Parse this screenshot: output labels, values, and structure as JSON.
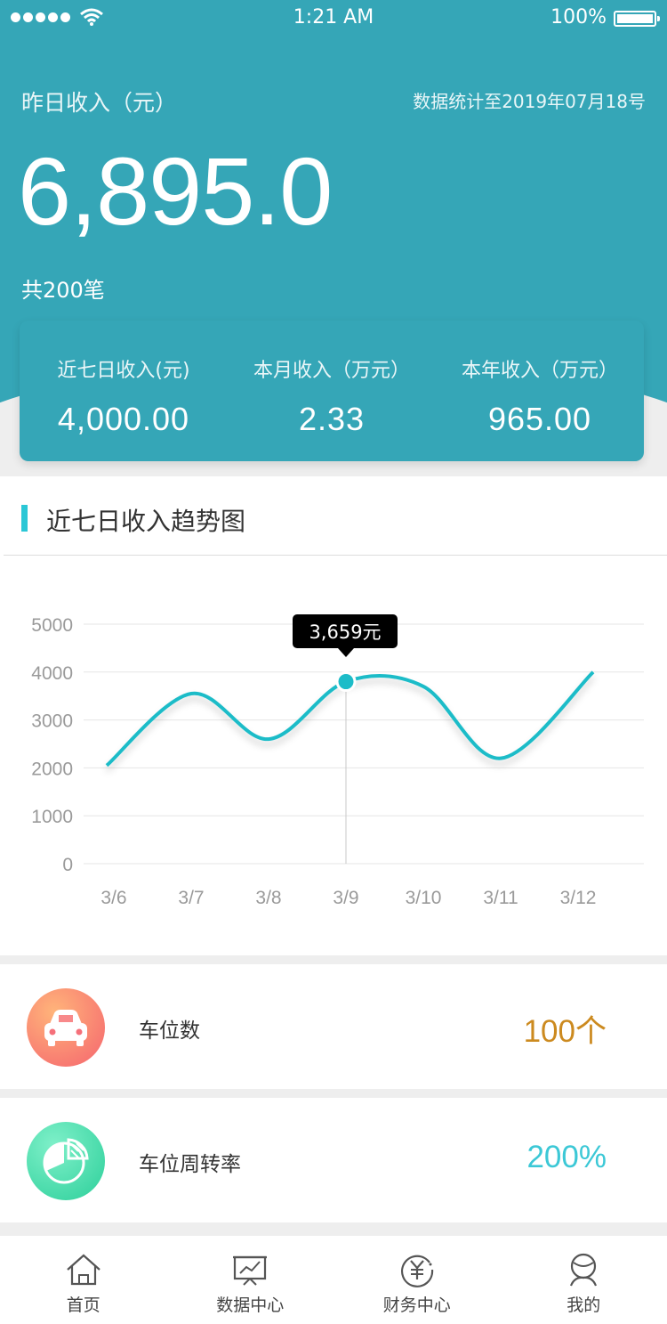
{
  "status": {
    "time": "1:21 AM",
    "battery": "100%"
  },
  "header": {
    "yesterday_label": "昨日收入（元）",
    "stat_date": "数据统计至2019年07月18号",
    "yesterday_value": "6,895.0",
    "count": "共200笔"
  },
  "summary": [
    {
      "label": "近七日收入(元)",
      "value": "4,000.00"
    },
    {
      "label": "本月收入（万元）",
      "value": "2.33"
    },
    {
      "label": "本年收入（万元）",
      "value": "965.00"
    }
  ],
  "chart_section": {
    "title": "近七日收入趋势图"
  },
  "chart_data": {
    "type": "line",
    "categories": [
      "3/6",
      "3/7",
      "3/8",
      "3/9",
      "3/10",
      "3/11",
      "3/12"
    ],
    "series": [
      {
        "values": [
          2050,
          3550,
          2600,
          3800,
          3700,
          2200,
          4000
        ]
      }
    ],
    "ylim": [
      0,
      5000
    ],
    "yticks": [
      0,
      1000,
      2000,
      3000,
      4000,
      5000
    ],
    "grid": true,
    "line_color": "#1dbcc8",
    "highlight": {
      "index": 3,
      "label": "3,659元"
    }
  },
  "stats": [
    {
      "name": "车位数",
      "value": "100个",
      "color": "#cc8a1f",
      "icon": "car-icon"
    },
    {
      "name": "车位周转率",
      "value": "200%",
      "color": "#3cc8d6",
      "icon": "pie-chart-icon"
    }
  ],
  "tabs": [
    {
      "label": "首页",
      "icon": "home-icon"
    },
    {
      "label": "数据中心",
      "icon": "data-center-icon"
    },
    {
      "label": "财务中心",
      "icon": "finance-icon"
    },
    {
      "label": "我的",
      "icon": "profile-icon"
    }
  ]
}
